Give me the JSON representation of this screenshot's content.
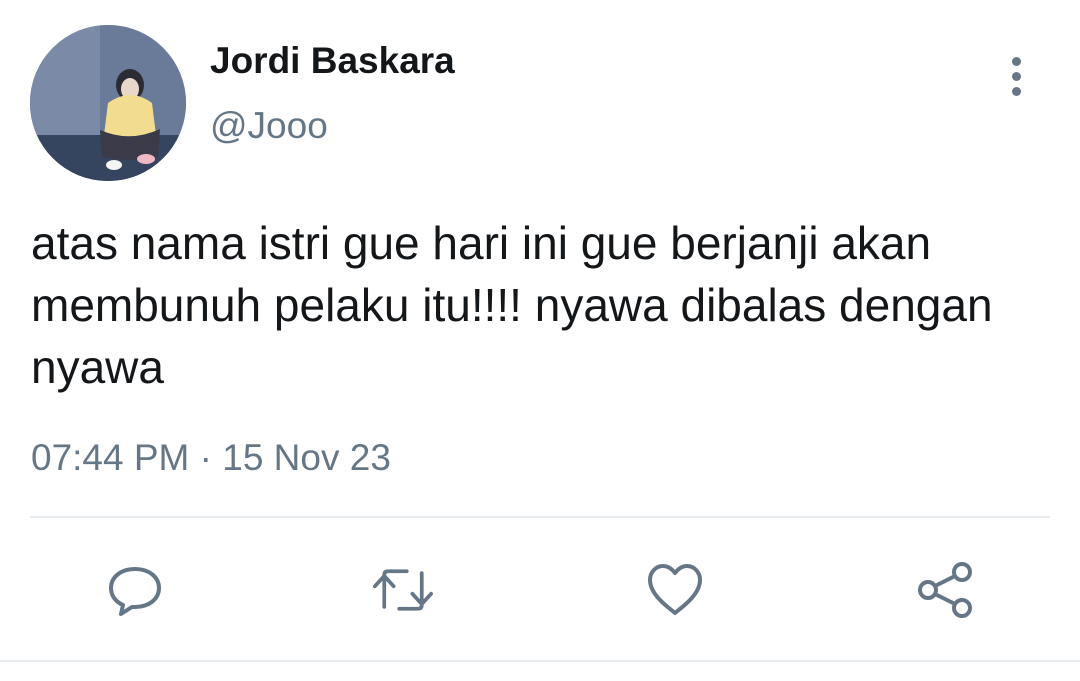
{
  "tweet": {
    "author": {
      "display_name": "Jordi Baskara",
      "handle": "@Jooo",
      "avatar": "avatar-photo"
    },
    "text": "atas nama istri gue hari ini gue berjanji akan membunuh pelaku itu!!!! nyawa dibalas dengan nyawa",
    "timestamp": "07:44 PM · 15 Nov 23"
  },
  "actions": [
    {
      "icon": "reply-icon"
    },
    {
      "icon": "retweet-icon"
    },
    {
      "icon": "like-icon"
    },
    {
      "icon": "share-icon"
    }
  ],
  "menu_icon": "more-vertical-icon",
  "colors": {
    "text": "#14171a",
    "secondary": "#657786",
    "divider": "#e6ecf0",
    "background": "#ffffff"
  }
}
